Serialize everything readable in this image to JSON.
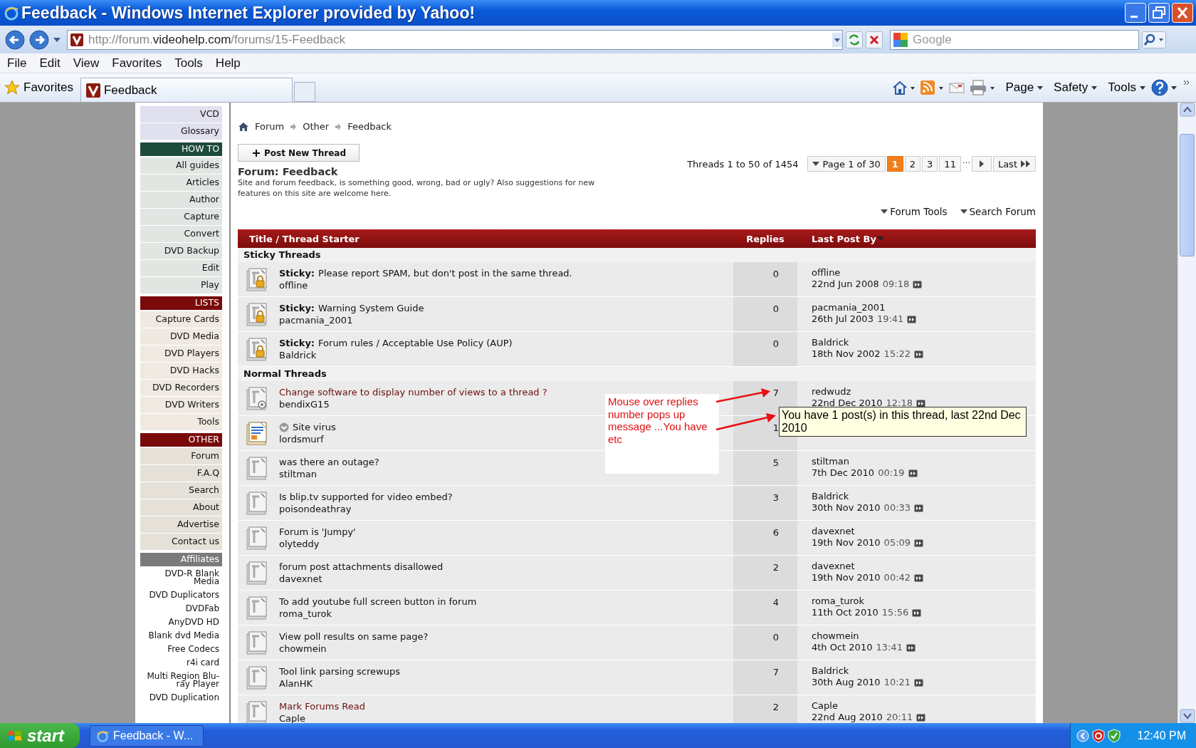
{
  "window": {
    "title": "Feedback - Windows Internet Explorer provided by Yahoo!"
  },
  "address_bar": {
    "url_start": "http://forum.",
    "url_domain": "videohelp.com",
    "url_end": "/forums/15-Feedback"
  },
  "search": {
    "placeholder": "Google"
  },
  "menu": [
    "File",
    "Edit",
    "View",
    "Favorites",
    "Tools",
    "Help"
  ],
  "favorites_bar": {
    "favorites": "Favorites",
    "tab": "Feedback"
  },
  "command_bar": [
    "Page",
    "Safety",
    "Tools"
  ],
  "sidebar": {
    "sections": [
      {
        "items": [
          "VCD",
          "Glossary"
        ]
      },
      {
        "heading": "HOW TO",
        "color": "#1e4a3c",
        "items": [
          "All guides",
          "Articles",
          "Author",
          "Capture",
          "Convert",
          "DVD Backup",
          "Edit",
          "Play"
        ]
      },
      {
        "heading": "LISTS",
        "color": "#7a0a0a",
        "items": [
          "Capture Cards",
          "DVD Media",
          "DVD Players",
          "DVD Hacks",
          "DVD Recorders",
          "DVD Writers",
          "Tools"
        ]
      },
      {
        "heading": "OTHER",
        "color": "#7a0a0a",
        "items": [
          "Forum",
          "F.A.Q",
          "Search",
          "About",
          "Advertise",
          "Contact us"
        ]
      },
      {
        "heading": "Affiliates",
        "color": "#7a7a7a",
        "items": [
          "DVD-R Blank Media",
          "DVD Duplicators",
          "DVDFab",
          "AnyDVD HD",
          "Blank dvd Media",
          "Free Codecs",
          "r4i card",
          "Multi Region Blu-ray Player",
          "DVD Duplication"
        ]
      }
    ]
  },
  "breadcrumb": [
    "Forum",
    "Other",
    "Feedback"
  ],
  "post_button": "Post New Thread",
  "forum_title": "Forum: Feedback",
  "description": "Site and forum feedback, is something good, wrong, bad or ugly? Also suggestions for new features on this site are welcome here.",
  "threads_count": "Threads 1 to 50 of 1454",
  "pagination": {
    "label": "Page 1 of 30",
    "pages": [
      {
        "label": "1",
        "selected": true
      },
      {
        "label": "2",
        "selected": false
      },
      {
        "label": "3",
        "selected": false
      },
      {
        "label": "11",
        "selected": false
      }
    ],
    "ellipsis": "…",
    "last": "Last"
  },
  "tools": [
    "Forum Tools",
    "Search Forum"
  ],
  "table": {
    "columns": [
      "Title / Thread Starter",
      "Replies",
      "Last Post By"
    ],
    "sections": [
      {
        "heading": "Sticky Threads",
        "rows": [
          {
            "kind": "locked",
            "prefix": "Sticky:",
            "title": "Please report SPAM, but don't post in the same thread.",
            "visited": false,
            "starter": "offline",
            "replies": "0",
            "last_poster": "offline",
            "last_date": "22nd Jun 2008",
            "last_time": "09:18"
          },
          {
            "kind": "locked",
            "prefix": "Sticky:",
            "title": "Warning System Guide",
            "visited": false,
            "starter": "pacmania_2001",
            "replies": "0",
            "last_poster": "pacmania_2001",
            "last_date": "26th Jul 2003",
            "last_time": "19:41"
          },
          {
            "kind": "locked",
            "prefix": "Sticky:",
            "title": "Forum rules / Acceptable Use Policy (AUP)",
            "visited": false,
            "starter": "Baldrick",
            "replies": "0",
            "last_poster": "Baldrick",
            "last_date": "18th Nov 2002",
            "last_time": "15:22"
          }
        ]
      },
      {
        "heading": "Normal Threads",
        "rows": [
          {
            "kind": "dot",
            "title": "Change software to display number of views to a thread ?",
            "visited": true,
            "starter": "bendixG15",
            "replies": "7",
            "last_poster": "redwudz",
            "last_date": "22nd Dec 2010",
            "last_time": "12:18"
          },
          {
            "kind": "new",
            "title_icon": true,
            "title": "Site virus",
            "visited": false,
            "starter": "lordsmurf",
            "replies": "1"
          },
          {
            "kind": "plain",
            "title": "was there an outage?",
            "visited": false,
            "starter": "stiltman",
            "replies": "5",
            "last_poster": "stiltman",
            "last_date": "7th Dec 2010",
            "last_time": "00:19"
          },
          {
            "kind": "plain",
            "title": "Is blip.tv supported for video embed?",
            "visited": false,
            "starter": "poisondeathray",
            "replies": "3",
            "last_poster": "Baldrick",
            "last_date": "30th Nov 2010",
            "last_time": "00:33"
          },
          {
            "kind": "plain",
            "title": "Forum is 'Jumpy'",
            "visited": false,
            "starter": "olyteddy",
            "replies": "6",
            "last_poster": "davexnet",
            "last_date": "19th Nov 2010",
            "last_time": "05:09"
          },
          {
            "kind": "plain",
            "title": "forum post attachments disallowed",
            "visited": false,
            "starter": "davexnet",
            "replies": "2",
            "last_poster": "davexnet",
            "last_date": "19th Nov 2010",
            "last_time": "00:42"
          },
          {
            "kind": "plain",
            "title": "To add youtube full screen button in forum",
            "visited": false,
            "starter": "roma_turok",
            "replies": "4",
            "last_poster": "roma_turok",
            "last_date": "11th Oct 2010",
            "last_time": "15:56"
          },
          {
            "kind": "plain",
            "title": "View poll results on same page?",
            "visited": false,
            "starter": "chowmein",
            "replies": "0",
            "last_poster": "chowmein",
            "last_date": "4th Oct 2010",
            "last_time": "13:41"
          },
          {
            "kind": "plain",
            "title": "Tool link parsing screwups",
            "visited": false,
            "starter": "AlanHK",
            "replies": "7",
            "last_poster": "Baldrick",
            "last_date": "30th Aug 2010",
            "last_time": "10:21"
          },
          {
            "kind": "plain",
            "title": "Mark Forums Read",
            "visited": true,
            "starter": "Caple",
            "replies": "2",
            "last_poster": "Caple",
            "last_date": "22nd Aug 2010",
            "last_time": "20:11"
          }
        ]
      }
    ]
  },
  "tooltip": {
    "text": "You have 1 post(s) in this thread, last 22nd Dec 2010"
  },
  "annotation": {
    "text": "Mouse over replies number pops up message ...You have etc"
  },
  "taskbar": {
    "start": "start",
    "task": "Feedback - W...",
    "clock": "12:40 PM"
  }
}
